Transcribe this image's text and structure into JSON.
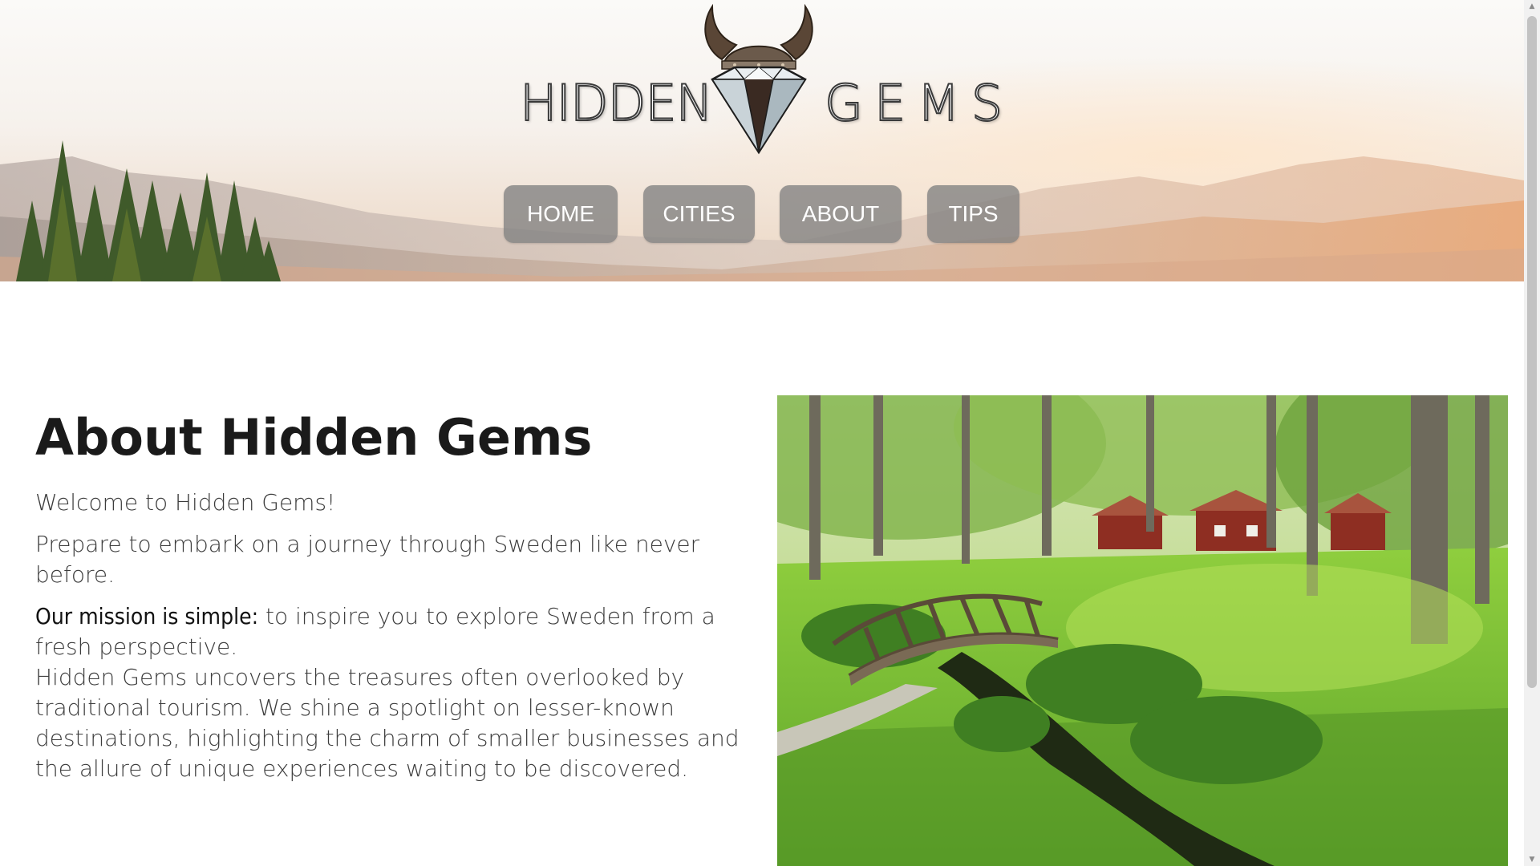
{
  "header": {
    "logo": {
      "word_left": "HIDDEN",
      "word_right": "GEMS",
      "icon": "viking-diamond-icon"
    },
    "nav": [
      {
        "label": "HOME"
      },
      {
        "label": "CITIES"
      },
      {
        "label": "ABOUT"
      },
      {
        "label": "TIPS"
      }
    ]
  },
  "main": {
    "title": "About Hidden Gems",
    "welcome": "Welcome to Hidden Gems!",
    "journey": "Prepare to embark on a journey through Sweden like never before.",
    "mission_lead": "Our mission is simple:",
    "mission_text": " to inspire you to explore Sweden from a fresh perspective.",
    "body": "Hidden Gems uncovers the treasures often overlooked by traditional tourism. We shine a spotlight on lesser-known destinations, highlighting the charm of smaller businesses and the allure of unique experiences waiting to be discovered.",
    "photo_icon": "forest-bridge-photo"
  },
  "colors": {
    "nav_button": "#808080",
    "title": "#1a1a1a",
    "body_text": "#3c3c3c"
  }
}
